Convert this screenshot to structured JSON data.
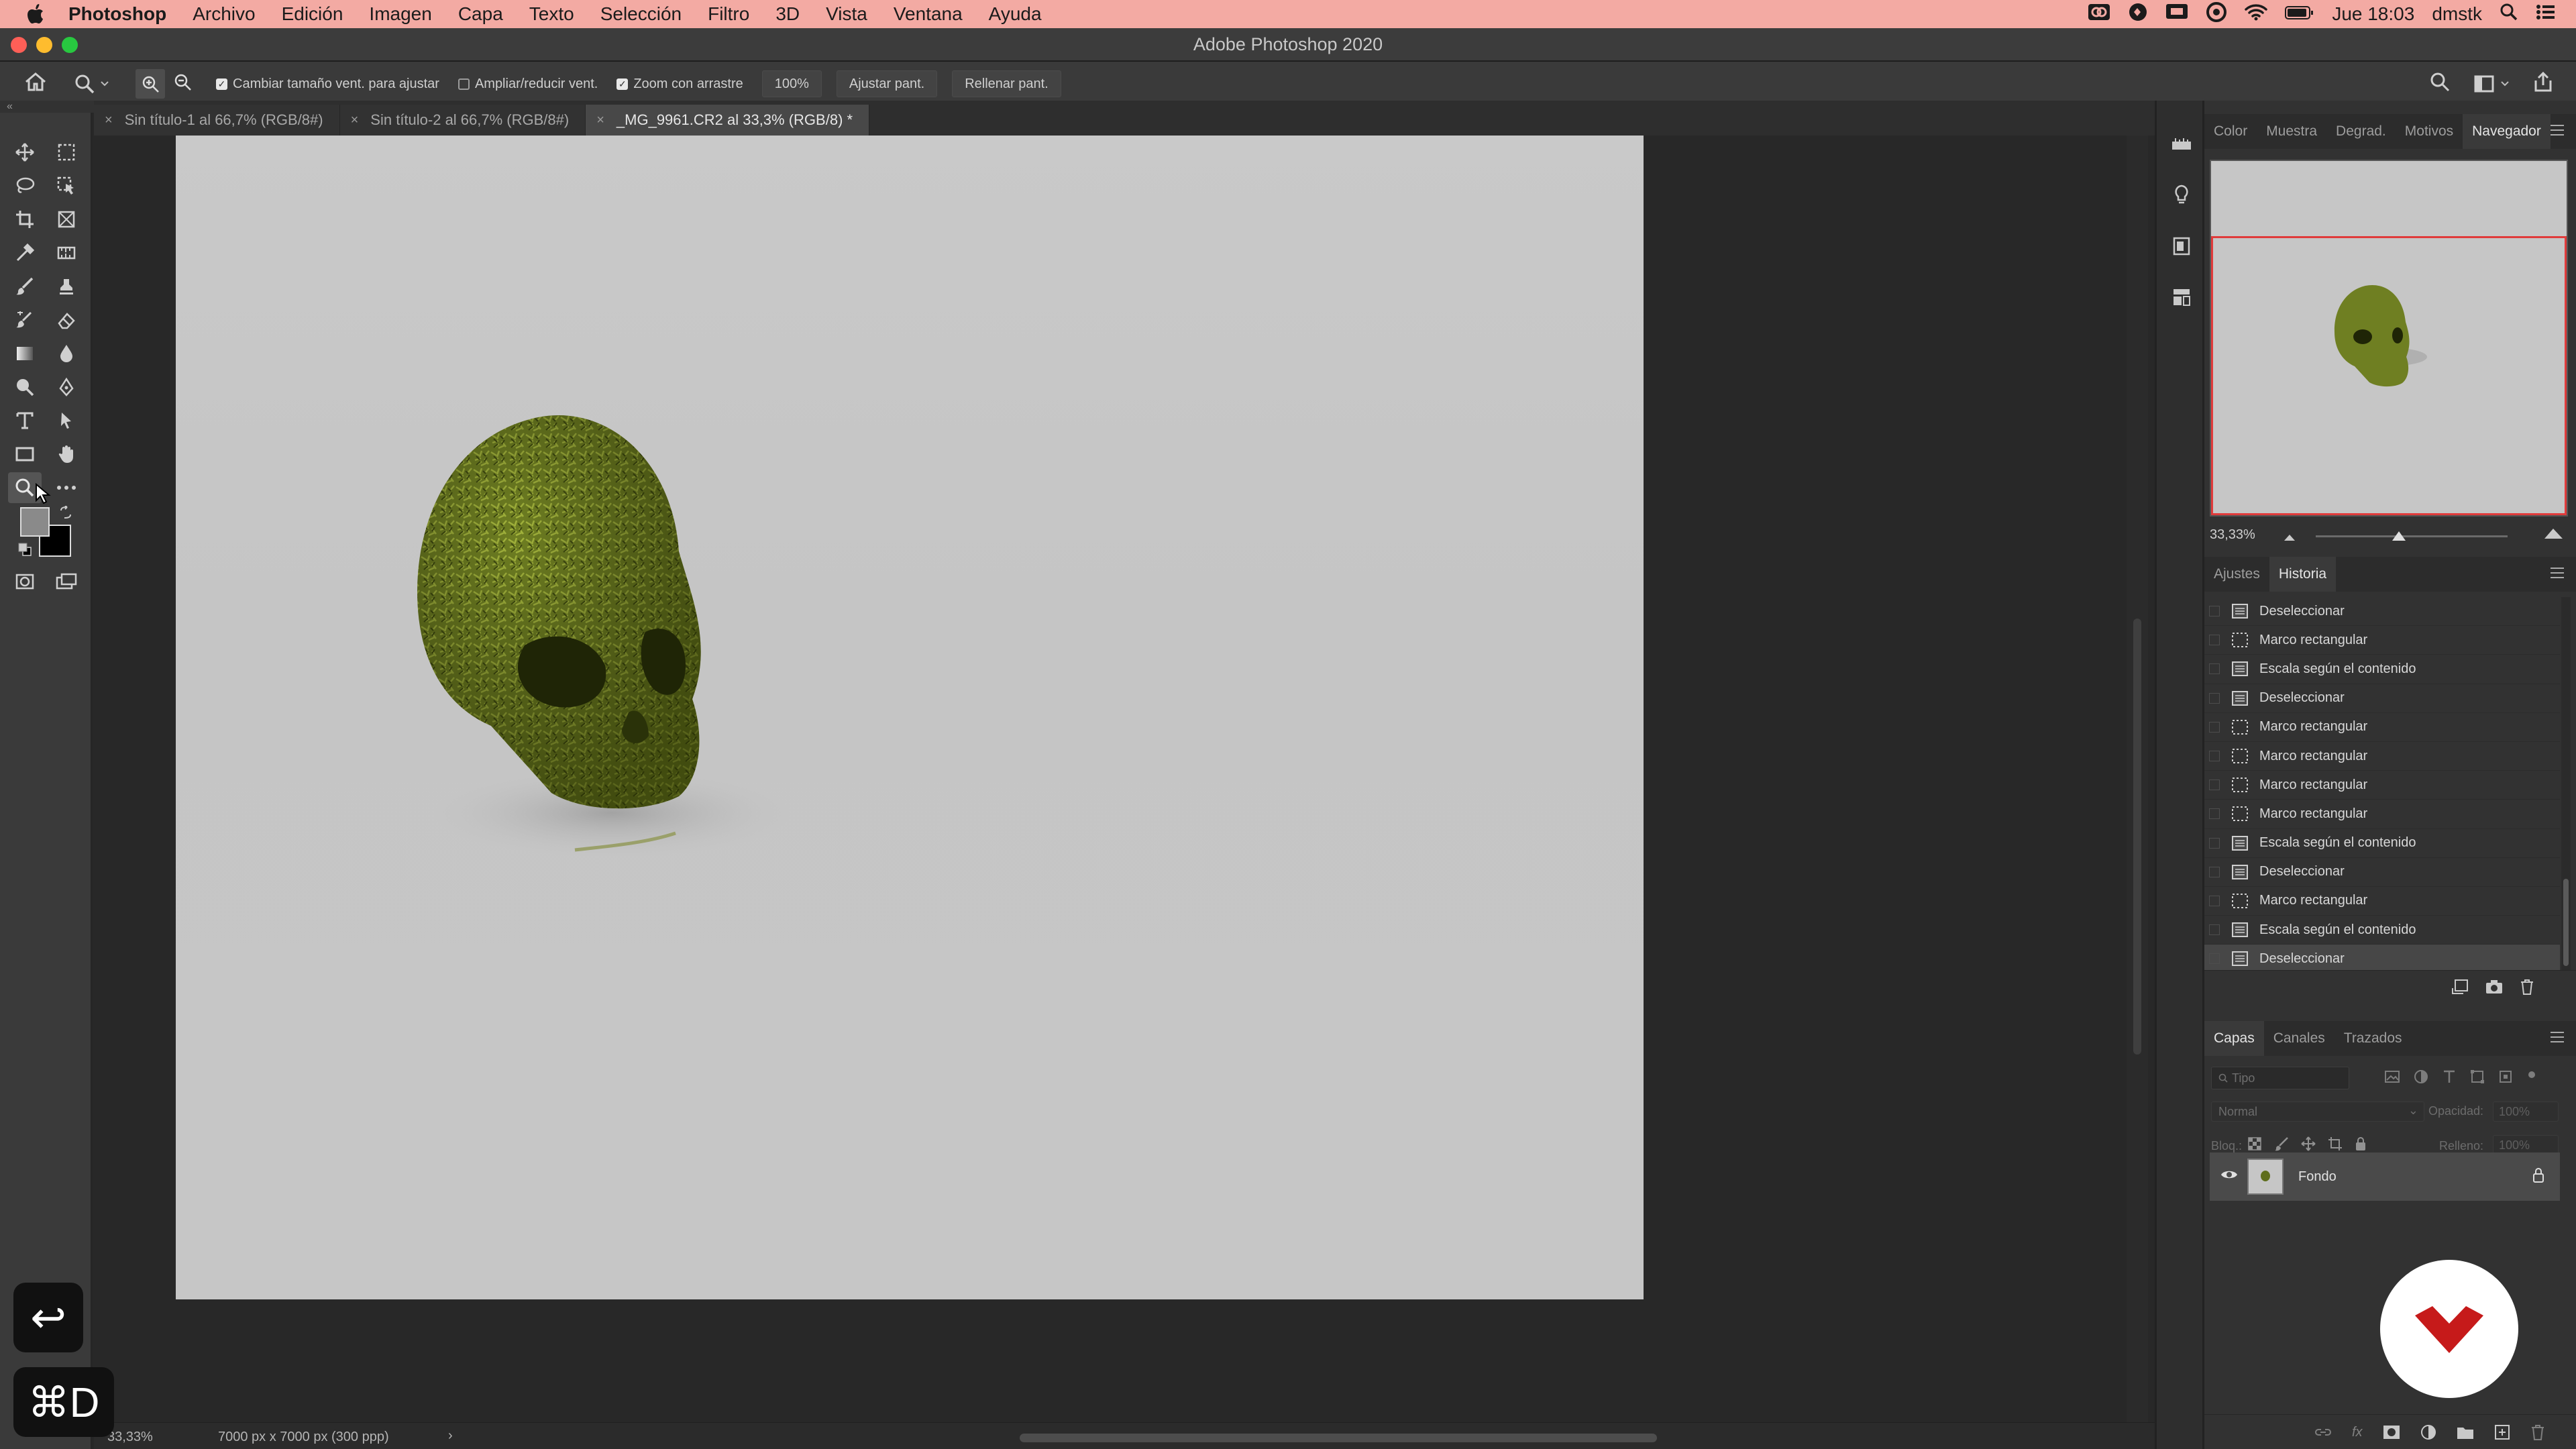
{
  "menubar": {
    "app_name": "Photoshop",
    "items": [
      "Archivo",
      "Edición",
      "Imagen",
      "Capa",
      "Texto",
      "Selección",
      "Filtro",
      "3D",
      "Vista",
      "Ventana",
      "Ayuda"
    ],
    "clock": "Jue 18:03",
    "user": "dmstk"
  },
  "window": {
    "title": "Adobe Photoshop 2020"
  },
  "options": {
    "resize_windows_label": "Cambiar tamaño vent. para ajustar",
    "zoom_all_label": "Ampliar/reducir vent.",
    "scrubby_zoom_label": "Zoom con arrastre",
    "zoom_value": "100%",
    "fit_screen_label": "Ajustar pant.",
    "fill_screen_label": "Rellenar pant."
  },
  "tabs": [
    {
      "label": "Sin título-1 al 66,7% (RGB/8#)"
    },
    {
      "label": "Sin título-2 al 66,7% (RGB/8#)"
    },
    {
      "label": "_MG_9961.CR2 al 33,3% (RGB/8) *"
    }
  ],
  "status": {
    "zoom": "33,33%",
    "doc_info": "7000 px x 7000 px (300 ppp)"
  },
  "top_panel": {
    "tabs": [
      "Color",
      "Muestra",
      "Degrad.",
      "Motivos",
      "Navegador"
    ],
    "zoom": "33,33%"
  },
  "history_panel": {
    "tabs": [
      "Ajustes",
      "Historia"
    ],
    "items": [
      {
        "label": "Deseleccionar",
        "icon": "document"
      },
      {
        "label": "Marco rectangular",
        "icon": "marquee"
      },
      {
        "label": "Escala según el contenido",
        "icon": "document"
      },
      {
        "label": "Deseleccionar",
        "icon": "document"
      },
      {
        "label": "Marco rectangular",
        "icon": "marquee"
      },
      {
        "label": "Marco rectangular",
        "icon": "marquee"
      },
      {
        "label": "Marco rectangular",
        "icon": "marquee"
      },
      {
        "label": "Marco rectangular",
        "icon": "marquee"
      },
      {
        "label": "Escala según el contenido",
        "icon": "document"
      },
      {
        "label": "Deseleccionar",
        "icon": "document"
      },
      {
        "label": "Marco rectangular",
        "icon": "marquee"
      },
      {
        "label": "Escala según el contenido",
        "icon": "document"
      },
      {
        "label": "Deseleccionar",
        "icon": "document"
      }
    ]
  },
  "layers_panel": {
    "tabs": [
      "Capas",
      "Canales",
      "Trazados"
    ],
    "search_placeholder": "Tipo",
    "blend_mode": "Normal",
    "opacity_label": "Opacidad:",
    "opacity_value": "100%",
    "lock_label": "Bloq.:",
    "fill_label": "Relleno:",
    "fill_value": "100%",
    "layers": [
      {
        "name": "Fondo",
        "visible": true,
        "locked": true
      }
    ]
  },
  "overlays": {
    "key_return": "↩",
    "key_combo": "⌘D"
  },
  "colors": {
    "menubar": "#f3aaa3",
    "accent_red": "#e03b3b",
    "skull_green": "#6b7a1f"
  }
}
